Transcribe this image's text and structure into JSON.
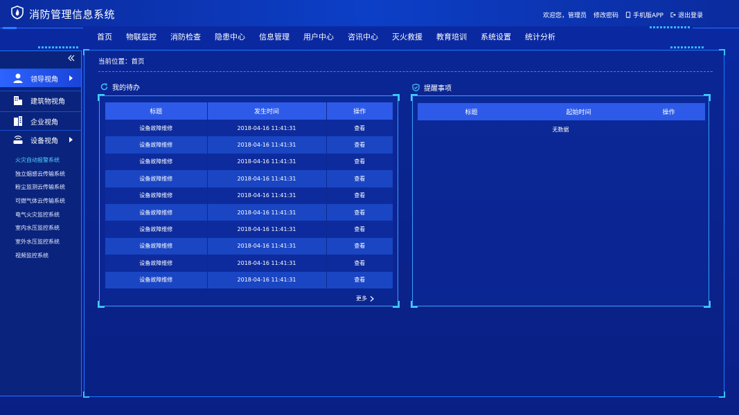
{
  "header": {
    "title": "消防管理信息系统",
    "links": {
      "welcome": "欢迎您，管理员",
      "change_password": "修改密码",
      "mobile_app": "手机版APP",
      "logout": "退出登录"
    }
  },
  "nav": [
    "首页",
    "物联监控",
    "消防检查",
    "隐患中心",
    "信息管理",
    "用户中心",
    "咨讯中心",
    "灭火救援",
    "教育培训",
    "系统设置",
    "统计分析"
  ],
  "sidebar": {
    "items": [
      {
        "label": "领导视角",
        "icon": "user-icon"
      },
      {
        "label": "建筑物视角",
        "icon": "building-icon"
      },
      {
        "label": "企业视角",
        "icon": "enterprise-icon"
      },
      {
        "label": "设备视角",
        "icon": "router-icon"
      }
    ],
    "sub_items": [
      "火灾自动报警系统",
      "独立烟感云传输系统",
      "粉尘监测云传输系统",
      "可燃气体云传输系统",
      "电气火灾监控系统",
      "室内水压监控系统",
      "室外水压监控系统",
      "视频监控系统"
    ]
  },
  "breadcrumb": "当前位置：首页",
  "todo": {
    "title": "我的待办",
    "headers": [
      "标题",
      "发生时间",
      "操作"
    ],
    "rows": [
      [
        "设备故障维修",
        "2018-04-16 11:41:31",
        "查看"
      ],
      [
        "设备故障维修",
        "2018-04-16 11:41:31",
        "查看"
      ],
      [
        "设备故障维修",
        "2018-04-16 11:41:31",
        "查看"
      ],
      [
        "设备故障维修",
        "2018-04-16 11:41:31",
        "查看"
      ],
      [
        "设备故障维修",
        "2018-04-16 11:41:31",
        "查看"
      ],
      [
        "设备故障维修",
        "2018-04-16 11:41:31",
        "查看"
      ],
      [
        "设备故障维修",
        "2018-04-16 11:41:31",
        "查看"
      ],
      [
        "设备故障维修",
        "2018-04-16 11:41:31",
        "查看"
      ],
      [
        "设备故障维修",
        "2018-04-16 11:41:31",
        "查看"
      ],
      [
        "设备故障维修",
        "2018-04-16 11:41:31",
        "查看"
      ]
    ],
    "more": "更多"
  },
  "reminders": {
    "title": "提醒事项",
    "headers": [
      "标题",
      "起始时间",
      "操作"
    ],
    "empty": "无数据"
  },
  "colors": {
    "accent": "#2d5ae8",
    "frame": "#1f7bff",
    "highlight": "#4fd4ff",
    "sidebar_active": "#2d63ff"
  }
}
